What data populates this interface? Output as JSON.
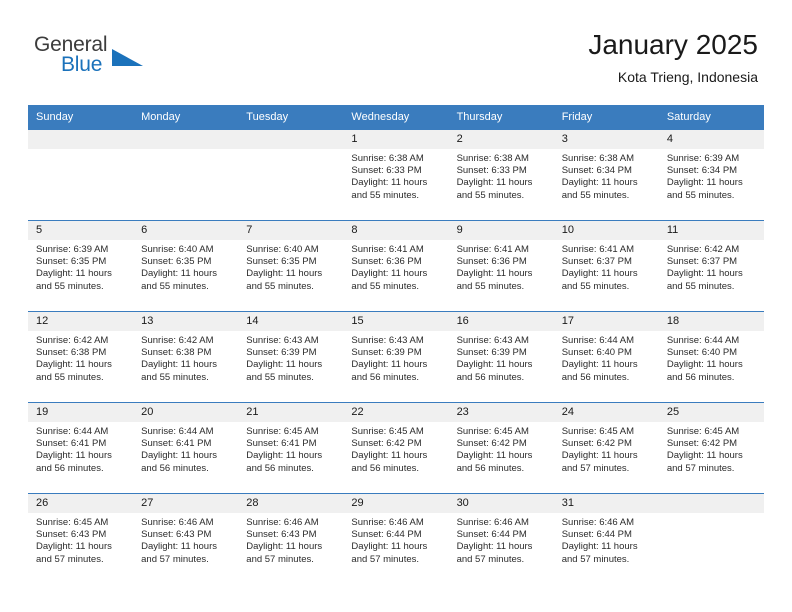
{
  "brand": {
    "name_part1": "General",
    "name_part2": "Blue",
    "logo_icon": "triangle-logo-icon",
    "accent_color": "#1b72bb"
  },
  "header": {
    "title": "January 2025",
    "location": "Kota Trieng, Indonesia"
  },
  "calendar": {
    "header_background": "#3a7cbe",
    "daynum_background": "#f0f0f0",
    "weekday_names": [
      "Sunday",
      "Monday",
      "Tuesday",
      "Wednesday",
      "Thursday",
      "Friday",
      "Saturday"
    ],
    "labels": {
      "sunrise": "Sunrise:",
      "sunset": "Sunset:",
      "daylight": "Daylight:"
    },
    "weeks": [
      [
        {
          "day": "",
          "sunrise": "",
          "sunset": "",
          "daylight_1": "",
          "daylight_2": ""
        },
        {
          "day": "",
          "sunrise": "",
          "sunset": "",
          "daylight_1": "",
          "daylight_2": ""
        },
        {
          "day": "",
          "sunrise": "",
          "sunset": "",
          "daylight_1": "",
          "daylight_2": ""
        },
        {
          "day": "1",
          "sunrise": "Sunrise: 6:38 AM",
          "sunset": "Sunset: 6:33 PM",
          "daylight_1": "Daylight: 11 hours",
          "daylight_2": "and 55 minutes."
        },
        {
          "day": "2",
          "sunrise": "Sunrise: 6:38 AM",
          "sunset": "Sunset: 6:33 PM",
          "daylight_1": "Daylight: 11 hours",
          "daylight_2": "and 55 minutes."
        },
        {
          "day": "3",
          "sunrise": "Sunrise: 6:38 AM",
          "sunset": "Sunset: 6:34 PM",
          "daylight_1": "Daylight: 11 hours",
          "daylight_2": "and 55 minutes."
        },
        {
          "day": "4",
          "sunrise": "Sunrise: 6:39 AM",
          "sunset": "Sunset: 6:34 PM",
          "daylight_1": "Daylight: 11 hours",
          "daylight_2": "and 55 minutes."
        }
      ],
      [
        {
          "day": "5",
          "sunrise": "Sunrise: 6:39 AM",
          "sunset": "Sunset: 6:35 PM",
          "daylight_1": "Daylight: 11 hours",
          "daylight_2": "and 55 minutes."
        },
        {
          "day": "6",
          "sunrise": "Sunrise: 6:40 AM",
          "sunset": "Sunset: 6:35 PM",
          "daylight_1": "Daylight: 11 hours",
          "daylight_2": "and 55 minutes."
        },
        {
          "day": "7",
          "sunrise": "Sunrise: 6:40 AM",
          "sunset": "Sunset: 6:35 PM",
          "daylight_1": "Daylight: 11 hours",
          "daylight_2": "and 55 minutes."
        },
        {
          "day": "8",
          "sunrise": "Sunrise: 6:41 AM",
          "sunset": "Sunset: 6:36 PM",
          "daylight_1": "Daylight: 11 hours",
          "daylight_2": "and 55 minutes."
        },
        {
          "day": "9",
          "sunrise": "Sunrise: 6:41 AM",
          "sunset": "Sunset: 6:36 PM",
          "daylight_1": "Daylight: 11 hours",
          "daylight_2": "and 55 minutes."
        },
        {
          "day": "10",
          "sunrise": "Sunrise: 6:41 AM",
          "sunset": "Sunset: 6:37 PM",
          "daylight_1": "Daylight: 11 hours",
          "daylight_2": "and 55 minutes."
        },
        {
          "day": "11",
          "sunrise": "Sunrise: 6:42 AM",
          "sunset": "Sunset: 6:37 PM",
          "daylight_1": "Daylight: 11 hours",
          "daylight_2": "and 55 minutes."
        }
      ],
      [
        {
          "day": "12",
          "sunrise": "Sunrise: 6:42 AM",
          "sunset": "Sunset: 6:38 PM",
          "daylight_1": "Daylight: 11 hours",
          "daylight_2": "and 55 minutes."
        },
        {
          "day": "13",
          "sunrise": "Sunrise: 6:42 AM",
          "sunset": "Sunset: 6:38 PM",
          "daylight_1": "Daylight: 11 hours",
          "daylight_2": "and 55 minutes."
        },
        {
          "day": "14",
          "sunrise": "Sunrise: 6:43 AM",
          "sunset": "Sunset: 6:39 PM",
          "daylight_1": "Daylight: 11 hours",
          "daylight_2": "and 55 minutes."
        },
        {
          "day": "15",
          "sunrise": "Sunrise: 6:43 AM",
          "sunset": "Sunset: 6:39 PM",
          "daylight_1": "Daylight: 11 hours",
          "daylight_2": "and 56 minutes."
        },
        {
          "day": "16",
          "sunrise": "Sunrise: 6:43 AM",
          "sunset": "Sunset: 6:39 PM",
          "daylight_1": "Daylight: 11 hours",
          "daylight_2": "and 56 minutes."
        },
        {
          "day": "17",
          "sunrise": "Sunrise: 6:44 AM",
          "sunset": "Sunset: 6:40 PM",
          "daylight_1": "Daylight: 11 hours",
          "daylight_2": "and 56 minutes."
        },
        {
          "day": "18",
          "sunrise": "Sunrise: 6:44 AM",
          "sunset": "Sunset: 6:40 PM",
          "daylight_1": "Daylight: 11 hours",
          "daylight_2": "and 56 minutes."
        }
      ],
      [
        {
          "day": "19",
          "sunrise": "Sunrise: 6:44 AM",
          "sunset": "Sunset: 6:41 PM",
          "daylight_1": "Daylight: 11 hours",
          "daylight_2": "and 56 minutes."
        },
        {
          "day": "20",
          "sunrise": "Sunrise: 6:44 AM",
          "sunset": "Sunset: 6:41 PM",
          "daylight_1": "Daylight: 11 hours",
          "daylight_2": "and 56 minutes."
        },
        {
          "day": "21",
          "sunrise": "Sunrise: 6:45 AM",
          "sunset": "Sunset: 6:41 PM",
          "daylight_1": "Daylight: 11 hours",
          "daylight_2": "and 56 minutes."
        },
        {
          "day": "22",
          "sunrise": "Sunrise: 6:45 AM",
          "sunset": "Sunset: 6:42 PM",
          "daylight_1": "Daylight: 11 hours",
          "daylight_2": "and 56 minutes."
        },
        {
          "day": "23",
          "sunrise": "Sunrise: 6:45 AM",
          "sunset": "Sunset: 6:42 PM",
          "daylight_1": "Daylight: 11 hours",
          "daylight_2": "and 56 minutes."
        },
        {
          "day": "24",
          "sunrise": "Sunrise: 6:45 AM",
          "sunset": "Sunset: 6:42 PM",
          "daylight_1": "Daylight: 11 hours",
          "daylight_2": "and 57 minutes."
        },
        {
          "day": "25",
          "sunrise": "Sunrise: 6:45 AM",
          "sunset": "Sunset: 6:42 PM",
          "daylight_1": "Daylight: 11 hours",
          "daylight_2": "and 57 minutes."
        }
      ],
      [
        {
          "day": "26",
          "sunrise": "Sunrise: 6:45 AM",
          "sunset": "Sunset: 6:43 PM",
          "daylight_1": "Daylight: 11 hours",
          "daylight_2": "and 57 minutes."
        },
        {
          "day": "27",
          "sunrise": "Sunrise: 6:46 AM",
          "sunset": "Sunset: 6:43 PM",
          "daylight_1": "Daylight: 11 hours",
          "daylight_2": "and 57 minutes."
        },
        {
          "day": "28",
          "sunrise": "Sunrise: 6:46 AM",
          "sunset": "Sunset: 6:43 PM",
          "daylight_1": "Daylight: 11 hours",
          "daylight_2": "and 57 minutes."
        },
        {
          "day": "29",
          "sunrise": "Sunrise: 6:46 AM",
          "sunset": "Sunset: 6:44 PM",
          "daylight_1": "Daylight: 11 hours",
          "daylight_2": "and 57 minutes."
        },
        {
          "day": "30",
          "sunrise": "Sunrise: 6:46 AM",
          "sunset": "Sunset: 6:44 PM",
          "daylight_1": "Daylight: 11 hours",
          "daylight_2": "and 57 minutes."
        },
        {
          "day": "31",
          "sunrise": "Sunrise: 6:46 AM",
          "sunset": "Sunset: 6:44 PM",
          "daylight_1": "Daylight: 11 hours",
          "daylight_2": "and 57 minutes."
        },
        {
          "day": "",
          "sunrise": "",
          "sunset": "",
          "daylight_1": "",
          "daylight_2": ""
        }
      ]
    ]
  }
}
